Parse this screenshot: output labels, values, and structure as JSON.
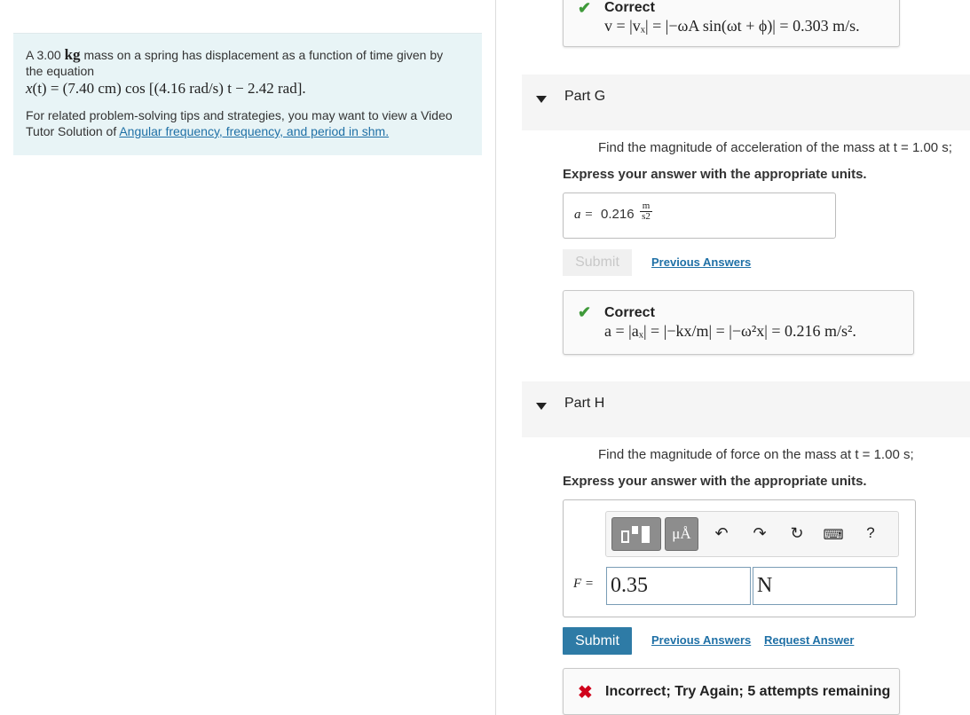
{
  "problem": {
    "line1_pre": "A 3.00 ",
    "line1_unit": "kg",
    "line1_post": " mass on a spring has displacement as a function of time given by",
    "line2": "the equation",
    "equation_lhs": "x",
    "equation_rest": "(t) = (7.40 cm)  cos  [(4.16 rad/s) t − 2.42 rad].",
    "tip_text": "For related problem-solving tips and strategies, you may want to view a Video Tutor Solution of ",
    "tip_link": "Angular frequency, frequency, and period in shm."
  },
  "partF_feedback": {
    "status": "Correct",
    "formula": "v = |vₓ| = |−ωA sin(ωt + ϕ)| = 0.303 m/s."
  },
  "partG": {
    "label": "Part G",
    "question": "Find the magnitude of acceleration of the mass at t = 1.00 s;",
    "express": "Express your answer with the appropriate units.",
    "answer_var": "a =",
    "answer_value": "0.216",
    "unit_num": "m",
    "unit_den": "s2",
    "submit_label": "Submit",
    "previous_answers_label": "Previous Answers",
    "feedback_status": "Correct",
    "feedback_formula": "a = |aₓ| = |−kx/m| = |−ω²x| = 0.216 m/s²."
  },
  "partH": {
    "label": "Part H",
    "question": "Find the magnitude of force on the mass at t = 1.00 s;",
    "express": "Express your answer with the appropriate units.",
    "answer_var": "F =",
    "value_input": "0.35",
    "unit_input": "N",
    "submit_label": "Submit",
    "previous_answers_label": "Previous Answers",
    "request_answer_label": "Request Answer",
    "feedback_status": "Incorrect; Try Again; 5 attempts remaining",
    "toolbar": {
      "units_label": "μÅ",
      "help_label": "?",
      "icons": [
        "templates-icon",
        "units-icon",
        "undo-icon",
        "redo-icon",
        "reset-icon",
        "keyboard-icon",
        "help-icon"
      ]
    }
  },
  "colors": {
    "accent": "#2e7ba6",
    "link": "#1f70a6",
    "correct": "#3f9a3a",
    "incorrect": "#d0021b",
    "problem_bg": "#e8f4f6"
  }
}
